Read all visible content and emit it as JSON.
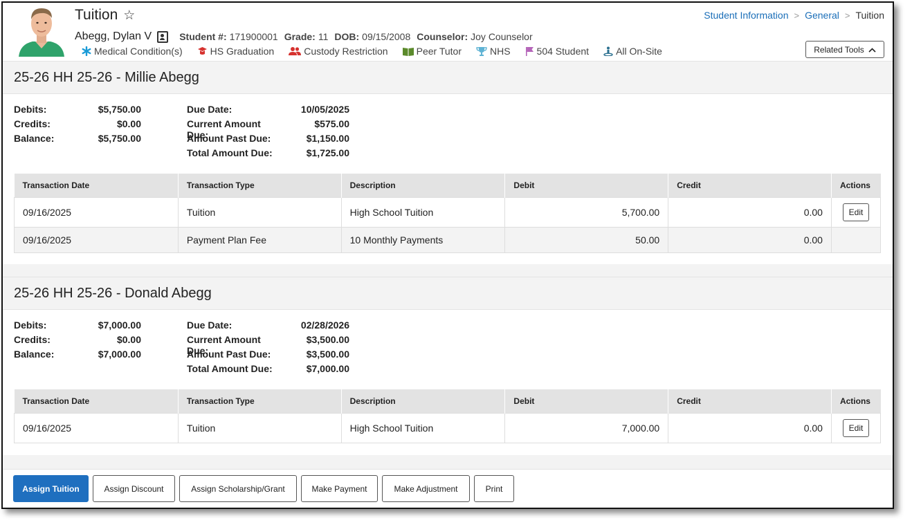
{
  "header": {
    "title": "Tuition",
    "breadcrumb": [
      "Student Information",
      "General",
      "Tuition"
    ],
    "student_name": "Abegg, Dylan V",
    "student_number_label": "Student #:",
    "student_number": "171900001",
    "grade_label": "Grade:",
    "grade": "11",
    "dob_label": "DOB:",
    "dob": "09/15/2008",
    "counselor_label": "Counselor:",
    "counselor": "Joy Counselor",
    "flags": [
      "Medical Condition(s)",
      "HS Graduation",
      "Custody Restriction",
      "Peer Tutor",
      "NHS",
      "504 Student",
      "All On-Site"
    ],
    "related_tools": "Related Tools"
  },
  "colors": {
    "link": "#1a6eb8",
    "primary_button": "#1f6fbf",
    "medical_flag": "#1a9bd7",
    "graduation_flag": "#d6322f",
    "custody_flag": "#d6322f",
    "tutor_flag": "#5b8a2b",
    "nhs_flag": "#5fb3d4",
    "504_flag": "#b565b9",
    "onsite_flag": "#2a6f8f"
  },
  "table_headers": [
    "Transaction Date",
    "Transaction Type",
    "Description",
    "Debit",
    "Credit",
    "Actions"
  ],
  "sections": [
    {
      "title": "25-26 HH 25-26 - Millie Abegg",
      "debits_label": "Debits:",
      "debits": "$5,750.00",
      "credits_label": "Credits:",
      "credits": "$0.00",
      "balance_label": "Balance:",
      "balance": "$5,750.00",
      "due_date_label": "Due Date:",
      "due_date": "10/05/2025",
      "current_label": "Current Amount Due:",
      "current": "$575.00",
      "past_label": "Amount Past Due:",
      "past": "$1,150.00",
      "total_label": "Total Amount Due:",
      "total": "$1,725.00",
      "rows": [
        {
          "date": "09/16/2025",
          "type": "Tuition",
          "description": "High School Tuition",
          "debit": "5,700.00",
          "credit": "0.00",
          "action": "Edit"
        },
        {
          "date": "09/16/2025",
          "type": "Payment Plan Fee",
          "description": "10 Monthly Payments",
          "debit": "50.00",
          "credit": "0.00",
          "action": ""
        }
      ]
    },
    {
      "title": "25-26 HH 25-26 - Donald Abegg",
      "debits_label": "Debits:",
      "debits": "$7,000.00",
      "credits_label": "Credits:",
      "credits": "$0.00",
      "balance_label": "Balance:",
      "balance": "$7,000.00",
      "due_date_label": "Due Date:",
      "due_date": "02/28/2026",
      "current_label": "Current Amount Due:",
      "current": "$3,500.00",
      "past_label": "Amount Past Due:",
      "past": "$3,500.00",
      "total_label": "Total Amount Due:",
      "total": "$7,000.00",
      "rows": [
        {
          "date": "09/16/2025",
          "type": "Tuition",
          "description": "High School Tuition",
          "debit": "7,000.00",
          "credit": "0.00",
          "action": "Edit"
        }
      ]
    }
  ],
  "footer": {
    "assign_tuition": "Assign Tuition",
    "assign_discount": "Assign Discount",
    "assign_scholarship": "Assign Scholarship/Grant",
    "make_payment": "Make Payment",
    "make_adjustment": "Make Adjustment",
    "print": "Print"
  }
}
